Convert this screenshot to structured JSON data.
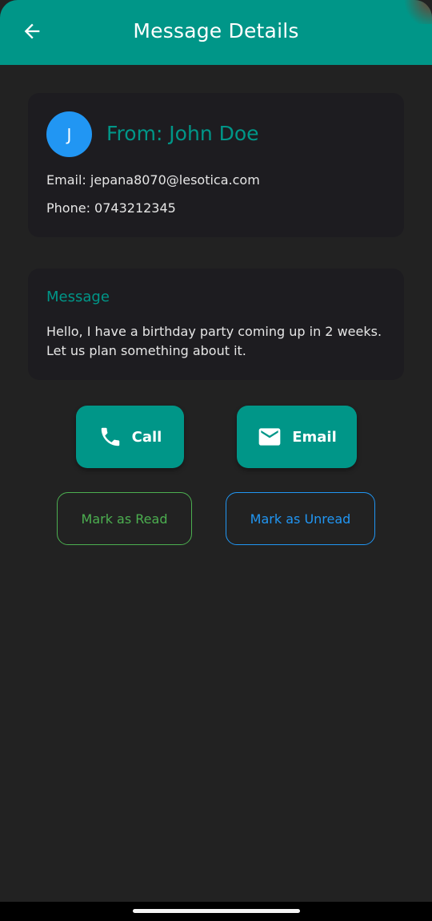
{
  "header": {
    "title": "Message Details",
    "back_icon": "arrow-back-icon"
  },
  "sender": {
    "avatar_initial": "J",
    "name_line": "From: John Doe",
    "email_line": "Email: jepana8070@lesotica.com",
    "phone_line": "Phone: 0743212345"
  },
  "message": {
    "heading": "Message",
    "body": "Hello, I have a birthday party coming up in 2 weeks. Let us plan something about it."
  },
  "actions": {
    "call_label": "Call",
    "call_icon": "phone-icon",
    "email_label": "Email",
    "email_icon": "mail-icon",
    "mark_read_label": "Mark as Read",
    "mark_unread_label": "Mark as Unread"
  },
  "colors": {
    "primary": "#009688",
    "background": "#222222",
    "card": "#1d1c20",
    "avatar": "#2196f3",
    "read_outline": "#4caf50",
    "unread_outline": "#2196f3"
  }
}
